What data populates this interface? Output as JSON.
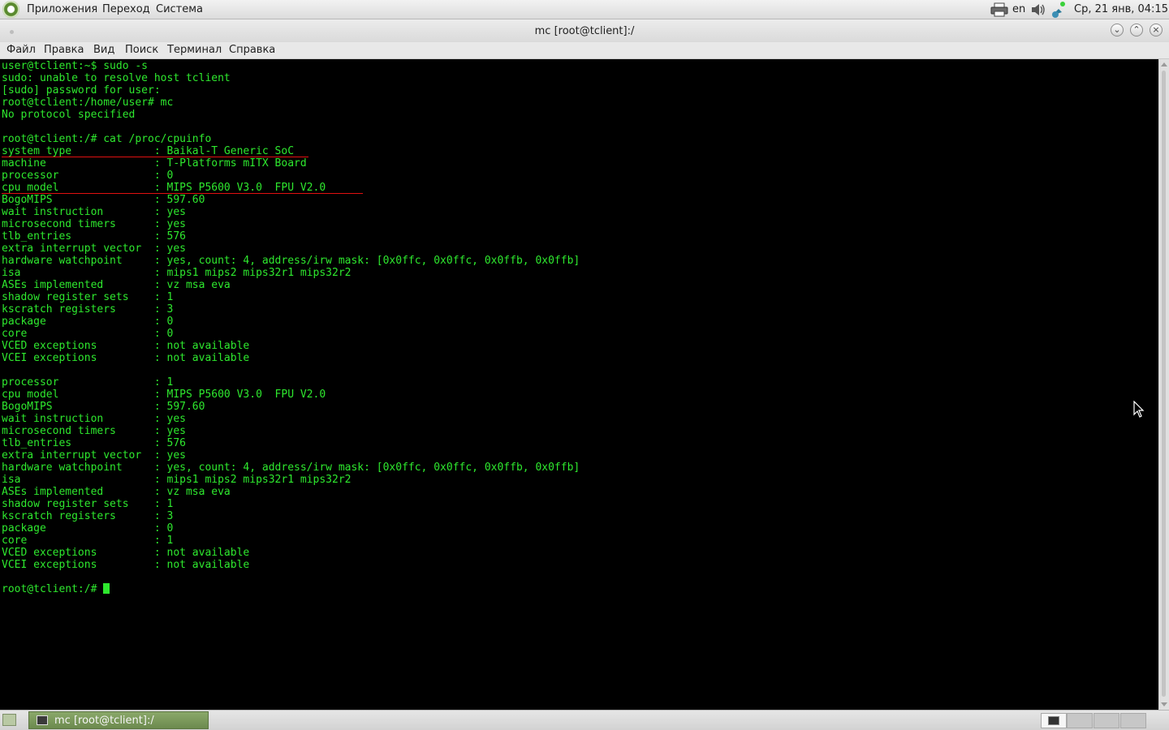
{
  "top_panel": {
    "menu": [
      "Приложения",
      "Переход",
      "Система"
    ],
    "keyboard_layout": "en",
    "datetime": "Ср, 21 янв, 04:15"
  },
  "window": {
    "title": "mc [root@tclient]:/"
  },
  "menubar": [
    "Файл",
    "Правка",
    "Вид",
    "Поиск",
    "Терминал",
    "Справка"
  ],
  "terminal": {
    "lines": [
      "user@tclient:~$ sudo -s",
      "sudo: unable to resolve host tclient",
      "[sudo] password for user:",
      "root@tclient:/home/user# mc",
      "No protocol specified",
      "",
      "root@tclient:/# cat /proc/cpuinfo",
      "system type             : Baikal-T Generic SoC",
      "machine                 : T-Platforms mITX Board",
      "processor               : 0",
      "cpu model               : MIPS P5600 V3.0  FPU V2.0",
      "BogoMIPS                : 597.60",
      "wait instruction        : yes",
      "microsecond timers      : yes",
      "tlb_entries             : 576",
      "extra interrupt vector  : yes",
      "hardware watchpoint     : yes, count: 4, address/irw mask: [0x0ffc, 0x0ffc, 0x0ffb, 0x0ffb]",
      "isa                     : mips1 mips2 mips32r1 mips32r2",
      "ASEs implemented        : vz msa eva",
      "shadow register sets    : 1",
      "kscratch registers      : 3",
      "package                 : 0",
      "core                    : 0",
      "VCED exceptions         : not available",
      "VCEI exceptions         : not available",
      "",
      "processor               : 1",
      "cpu model               : MIPS P5600 V3.0  FPU V2.0",
      "BogoMIPS                : 597.60",
      "wait instruction        : yes",
      "microsecond timers      : yes",
      "tlb_entries             : 576",
      "extra interrupt vector  : yes",
      "hardware watchpoint     : yes, count: 4, address/irw mask: [0x0ffc, 0x0ffc, 0x0ffb, 0x0ffb]",
      "isa                     : mips1 mips2 mips32r1 mips32r2",
      "ASEs implemented        : vz msa eva",
      "shadow register sets    : 1",
      "kscratch registers      : 3",
      "package                 : 0",
      "core                    : 1",
      "VCED exceptions         : not available",
      "VCEI exceptions         : not available",
      ""
    ],
    "prompt": "root@tclient:/# ",
    "text_color": "#2ee82e",
    "background_color": "#000000",
    "highlight_color": "#e01010"
  },
  "taskbar": {
    "task_label": "mc [root@tclient]:/",
    "active_color": "#7a985c"
  }
}
